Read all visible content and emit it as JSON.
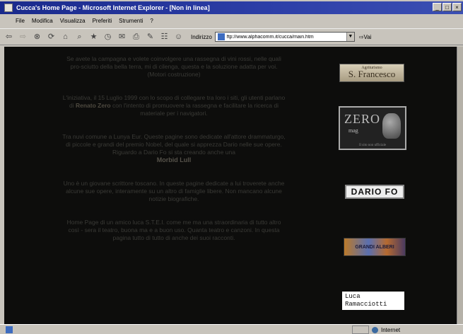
{
  "window": {
    "title": "Cucca's Home Page - Microsoft Internet Explorer - [Non in linea]",
    "buttons": [
      "_",
      "□",
      "×"
    ]
  },
  "menu": [
    "File",
    "Modifica",
    "Visualizza",
    "Preferiti",
    "Strumenti",
    "?"
  ],
  "address": {
    "label": "Indirizzo",
    "url": "ftp://www.alphacomm.it/cucca/main.htm",
    "go": "Vai"
  },
  "content": {
    "paragraphs": [
      {
        "text": "Se avete la campagna e volete coinvolgere una rassegna di vini rossi, nelle quali pro-sciutto della bella terra, mi di cilenga, questa e la soluzione adatta per voi. (Motori costruzione)"
      },
      {
        "pre": "L'iniziativa, il 15 Luglio 1999 con lo scopo di collegare tra loro i siti, gli utenti parlano di ",
        "name": "Renato Zero",
        "post": " con l'intento di promuovere la rassegna e facilitare la ricerca di materiale per i navigatori."
      },
      {
        "text": "Tra nuvi comune a Lunya Eur. Queste pagine sono dedicate all'attore drammaturgo, di piccole e grandi del premio Nobel, del quale si apprezza Dario nelle sue opere. Riguardo a Dario Fo si sta creando anche una",
        "sig": "Morbid Lull"
      },
      {
        "text": "Uno è un giovane scrittore toscano. In queste pagine dedicate a lui troverete anche alcune sue opere, interamente su un altro di famiglie libere. Non mancano alcune notizie biografiche."
      },
      {
        "text": "Home Page di un amico luca S.T.E.I. come me ma una straordinaria di tutto altro così - sera il teatro, buona ma e a buon uso. Quanta teatro e canzoni. In questa pagina tutto di tutto di anche dei suoi racconti."
      }
    ],
    "logos": {
      "sf_small": "Agriturismo",
      "sf": "S. Francesco",
      "zero_big": "ZERO",
      "zero_small": "mag",
      "zero_foot": "Il sito non ufficiale",
      "dario": "DARIO FO",
      "banner": "GRANDI ALBERI",
      "luca_1": "Luca",
      "luca_2": "Ramacciotti"
    }
  },
  "status": {
    "text": "",
    "zone": "Internet"
  }
}
